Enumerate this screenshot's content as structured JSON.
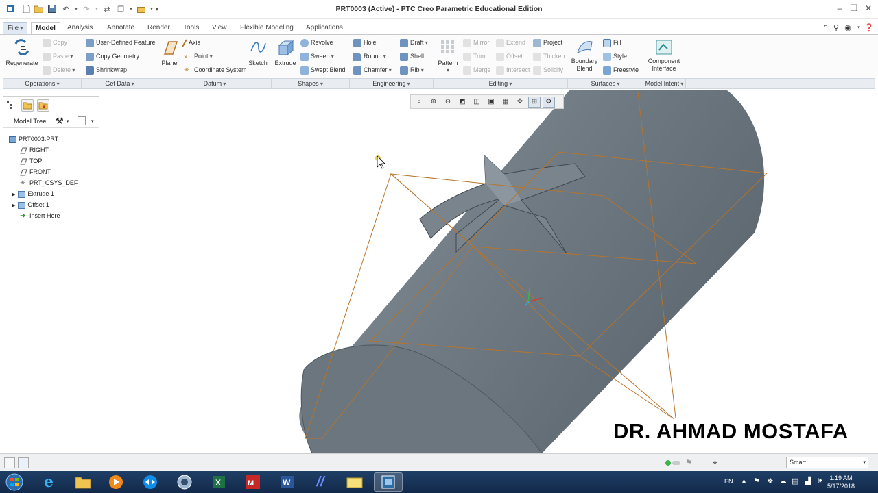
{
  "window": {
    "title": "PRT0003 (Active) - PTC Creo Parametric Educational Edition"
  },
  "tabs": [
    {
      "label": "File",
      "dropdown": true
    },
    {
      "label": "Model",
      "active": true
    },
    {
      "label": "Analysis"
    },
    {
      "label": "Annotate"
    },
    {
      "label": "Render"
    },
    {
      "label": "Tools"
    },
    {
      "label": "View"
    },
    {
      "label": "Flexible Modeling"
    },
    {
      "label": "Applications"
    }
  ],
  "ribbon": {
    "operations": {
      "regenerate": "Regenerate",
      "copy": "Copy",
      "paste": "Paste",
      "delete": "Delete"
    },
    "get_data": {
      "udf": "User-Defined Feature",
      "copy_geometry": "Copy Geometry",
      "shrinkwrap": "Shrinkwrap"
    },
    "datum": {
      "plane": "Plane",
      "axis": "Axis",
      "point": "Point",
      "csys": "Coordinate System",
      "sketch": "Sketch"
    },
    "shapes": {
      "extrude": "Extrude",
      "revolve": "Revolve",
      "sweep": "Sweep",
      "swept_blend": "Swept Blend"
    },
    "engineering": {
      "hole": "Hole",
      "round": "Round",
      "chamfer": "Chamfer",
      "draft": "Draft",
      "shell": "Shell",
      "rib": "Rib"
    },
    "editing": {
      "pattern": "Pattern",
      "mirror": "Mirror",
      "trim": "Trim",
      "merge": "Merge",
      "extend": "Extend",
      "offset": "Offset",
      "intersect": "Intersect",
      "project": "Project",
      "thicken": "Thicken",
      "solidify": "Solidify"
    },
    "surfaces": {
      "boundary_blend": "Boundary Blend",
      "fill": "Fill",
      "style": "Style",
      "freestyle": "Freestyle"
    },
    "model_intent": {
      "component_interface": "Component Interface"
    }
  },
  "groups": [
    "Operations",
    "Get Data",
    "Datum",
    "Shapes",
    "Engineering",
    "Editing",
    "Surfaces",
    "Model Intent"
  ],
  "model_tree": {
    "title": "Model Tree",
    "items": [
      {
        "label": "PRT0003.PRT",
        "icon": "part-icon"
      },
      {
        "label": "RIGHT",
        "icon": "datum-plane-icon"
      },
      {
        "label": "TOP",
        "icon": "datum-plane-icon"
      },
      {
        "label": "FRONT",
        "icon": "datum-plane-icon"
      },
      {
        "label": "PRT_CSYS_DEF",
        "icon": "csys-icon"
      },
      {
        "label": "Extrude 1",
        "icon": "extrude-icon"
      },
      {
        "label": "Offset 1",
        "icon": "offset-icon"
      },
      {
        "label": "Insert Here",
        "icon": "insert-arrow-icon"
      }
    ]
  },
  "graphics_toolbar": [
    "refit-icon",
    "zoom-in-icon",
    "zoom-out-icon",
    "repaint-icon",
    "display-style-icon",
    "saved-orientations-icon",
    "view-manager-icon",
    "datum-display-icon",
    "spin-center-icon",
    "annotation-display-icon"
  ],
  "watermark": "DR. AHMAD MOSTAFA",
  "status": {
    "filter": "Smart"
  },
  "taskbar": {
    "clock_time": "1:19 AM",
    "clock_date": "5/17/2018",
    "lang": "EN"
  },
  "colors": {
    "model_fill": "#6f7a83",
    "datum_orange": "#b8742a",
    "ribbon_bg": "#fbfbfb",
    "taskbar": "#1a355a"
  }
}
